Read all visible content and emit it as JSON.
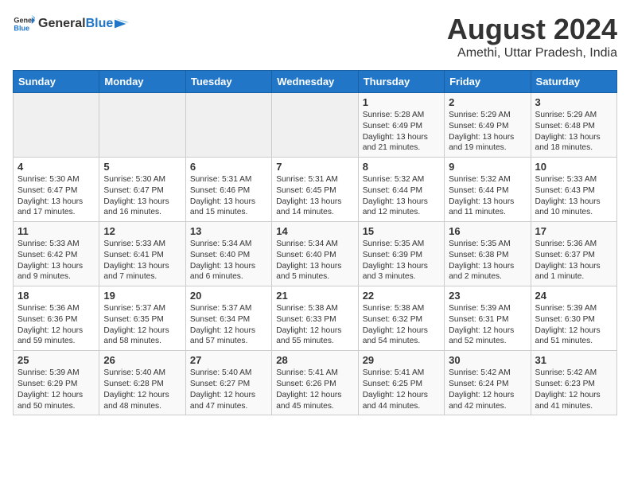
{
  "header": {
    "logo_general": "General",
    "logo_blue": "Blue",
    "month_year": "August 2024",
    "location": "Amethi, Uttar Pradesh, India"
  },
  "days_of_week": [
    "Sunday",
    "Monday",
    "Tuesday",
    "Wednesday",
    "Thursday",
    "Friday",
    "Saturday"
  ],
  "weeks": [
    [
      {
        "day": "",
        "content": ""
      },
      {
        "day": "",
        "content": ""
      },
      {
        "day": "",
        "content": ""
      },
      {
        "day": "",
        "content": ""
      },
      {
        "day": "1",
        "content": "Sunrise: 5:28 AM\nSunset: 6:49 PM\nDaylight: 13 hours\nand 21 minutes."
      },
      {
        "day": "2",
        "content": "Sunrise: 5:29 AM\nSunset: 6:49 PM\nDaylight: 13 hours\nand 19 minutes."
      },
      {
        "day": "3",
        "content": "Sunrise: 5:29 AM\nSunset: 6:48 PM\nDaylight: 13 hours\nand 18 minutes."
      }
    ],
    [
      {
        "day": "4",
        "content": "Sunrise: 5:30 AM\nSunset: 6:47 PM\nDaylight: 13 hours\nand 17 minutes."
      },
      {
        "day": "5",
        "content": "Sunrise: 5:30 AM\nSunset: 6:47 PM\nDaylight: 13 hours\nand 16 minutes."
      },
      {
        "day": "6",
        "content": "Sunrise: 5:31 AM\nSunset: 6:46 PM\nDaylight: 13 hours\nand 15 minutes."
      },
      {
        "day": "7",
        "content": "Sunrise: 5:31 AM\nSunset: 6:45 PM\nDaylight: 13 hours\nand 14 minutes."
      },
      {
        "day": "8",
        "content": "Sunrise: 5:32 AM\nSunset: 6:44 PM\nDaylight: 13 hours\nand 12 minutes."
      },
      {
        "day": "9",
        "content": "Sunrise: 5:32 AM\nSunset: 6:44 PM\nDaylight: 13 hours\nand 11 minutes."
      },
      {
        "day": "10",
        "content": "Sunrise: 5:33 AM\nSunset: 6:43 PM\nDaylight: 13 hours\nand 10 minutes."
      }
    ],
    [
      {
        "day": "11",
        "content": "Sunrise: 5:33 AM\nSunset: 6:42 PM\nDaylight: 13 hours\nand 9 minutes."
      },
      {
        "day": "12",
        "content": "Sunrise: 5:33 AM\nSunset: 6:41 PM\nDaylight: 13 hours\nand 7 minutes."
      },
      {
        "day": "13",
        "content": "Sunrise: 5:34 AM\nSunset: 6:40 PM\nDaylight: 13 hours\nand 6 minutes."
      },
      {
        "day": "14",
        "content": "Sunrise: 5:34 AM\nSunset: 6:40 PM\nDaylight: 13 hours\nand 5 minutes."
      },
      {
        "day": "15",
        "content": "Sunrise: 5:35 AM\nSunset: 6:39 PM\nDaylight: 13 hours\nand 3 minutes."
      },
      {
        "day": "16",
        "content": "Sunrise: 5:35 AM\nSunset: 6:38 PM\nDaylight: 13 hours\nand 2 minutes."
      },
      {
        "day": "17",
        "content": "Sunrise: 5:36 AM\nSunset: 6:37 PM\nDaylight: 13 hours\nand 1 minute."
      }
    ],
    [
      {
        "day": "18",
        "content": "Sunrise: 5:36 AM\nSunset: 6:36 PM\nDaylight: 12 hours\nand 59 minutes."
      },
      {
        "day": "19",
        "content": "Sunrise: 5:37 AM\nSunset: 6:35 PM\nDaylight: 12 hours\nand 58 minutes."
      },
      {
        "day": "20",
        "content": "Sunrise: 5:37 AM\nSunset: 6:34 PM\nDaylight: 12 hours\nand 57 minutes."
      },
      {
        "day": "21",
        "content": "Sunrise: 5:38 AM\nSunset: 6:33 PM\nDaylight: 12 hours\nand 55 minutes."
      },
      {
        "day": "22",
        "content": "Sunrise: 5:38 AM\nSunset: 6:32 PM\nDaylight: 12 hours\nand 54 minutes."
      },
      {
        "day": "23",
        "content": "Sunrise: 5:39 AM\nSunset: 6:31 PM\nDaylight: 12 hours\nand 52 minutes."
      },
      {
        "day": "24",
        "content": "Sunrise: 5:39 AM\nSunset: 6:30 PM\nDaylight: 12 hours\nand 51 minutes."
      }
    ],
    [
      {
        "day": "25",
        "content": "Sunrise: 5:39 AM\nSunset: 6:29 PM\nDaylight: 12 hours\nand 50 minutes."
      },
      {
        "day": "26",
        "content": "Sunrise: 5:40 AM\nSunset: 6:28 PM\nDaylight: 12 hours\nand 48 minutes."
      },
      {
        "day": "27",
        "content": "Sunrise: 5:40 AM\nSunset: 6:27 PM\nDaylight: 12 hours\nand 47 minutes."
      },
      {
        "day": "28",
        "content": "Sunrise: 5:41 AM\nSunset: 6:26 PM\nDaylight: 12 hours\nand 45 minutes."
      },
      {
        "day": "29",
        "content": "Sunrise: 5:41 AM\nSunset: 6:25 PM\nDaylight: 12 hours\nand 44 minutes."
      },
      {
        "day": "30",
        "content": "Sunrise: 5:42 AM\nSunset: 6:24 PM\nDaylight: 12 hours\nand 42 minutes."
      },
      {
        "day": "31",
        "content": "Sunrise: 5:42 AM\nSunset: 6:23 PM\nDaylight: 12 hours\nand 41 minutes."
      }
    ]
  ]
}
